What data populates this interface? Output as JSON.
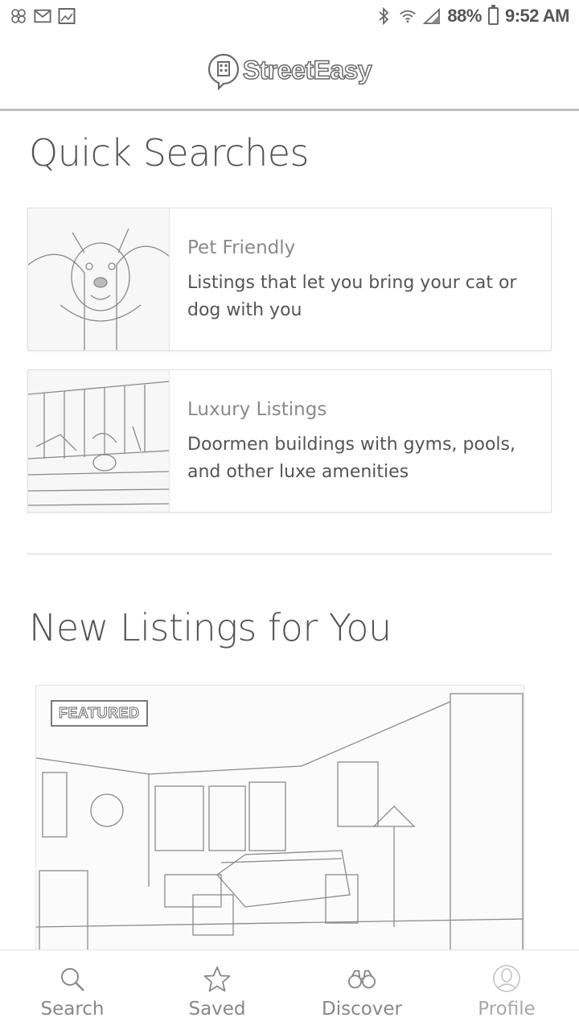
{
  "status_bar": {
    "left_icons": [
      "pinwheel-icon",
      "gmail-icon",
      "image-icon"
    ],
    "right_icons": [
      "bluetooth-icon",
      "wifi-icon",
      "signal-icon"
    ],
    "battery": "88%",
    "time": "9:52 AM"
  },
  "app_bar": {
    "logo_text": "StreetEasy"
  },
  "quick_searches": {
    "title": "Quick Searches",
    "items": [
      {
        "name": "Pet Friendly",
        "description": "Listings that let you bring your cat or dog with you"
      },
      {
        "name": "Luxury Listings",
        "description": "Doormen buildings with gyms, pools, and other luxe amenities"
      }
    ]
  },
  "new_listings": {
    "title": "New Listings for You",
    "featured_badge": "FEATURED"
  },
  "bottom_nav": {
    "items": [
      {
        "label": "Search",
        "icon": "search-icon"
      },
      {
        "label": "Saved",
        "icon": "star-icon"
      },
      {
        "label": "Discover",
        "icon": "binoculars-icon"
      },
      {
        "label": "Profile",
        "icon": "profile-icon"
      }
    ]
  }
}
